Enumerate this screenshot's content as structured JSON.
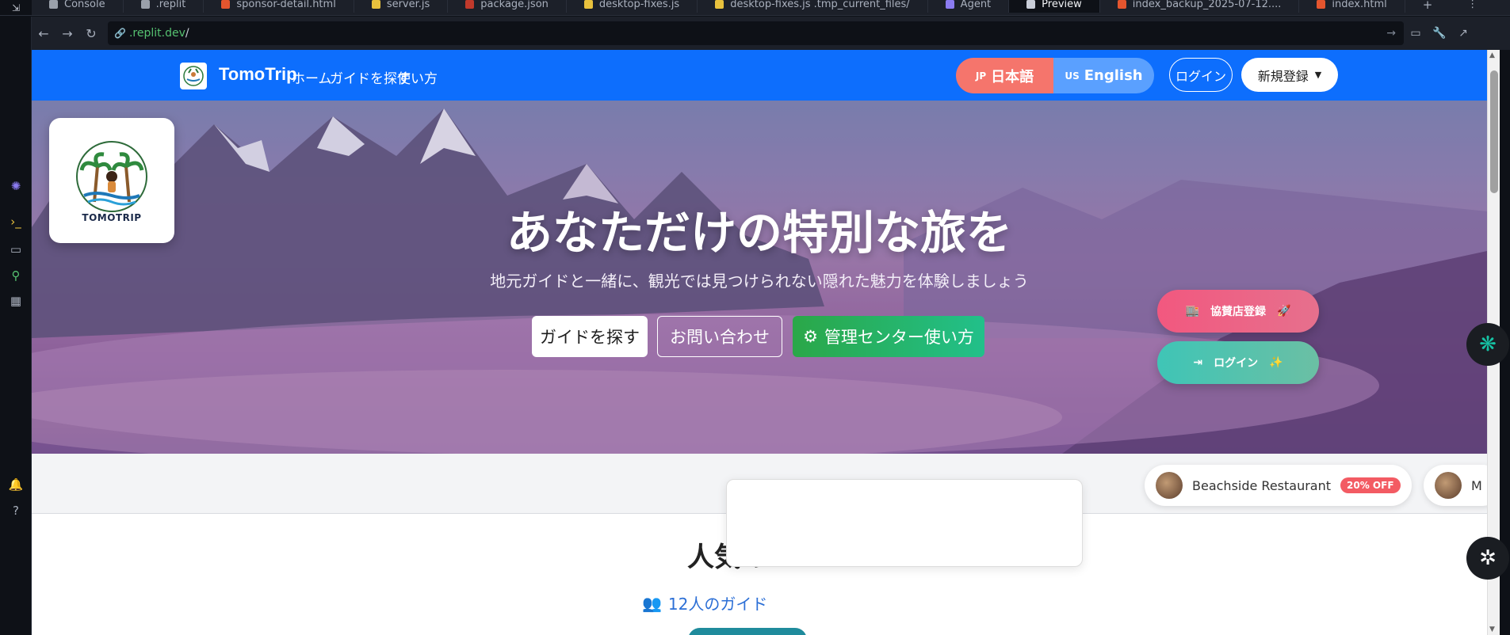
{
  "browser": {
    "tabs": [
      {
        "label": "Console",
        "color": "#9aa0aa"
      },
      {
        "label": ".replit",
        "color": "#9aa0aa"
      },
      {
        "label": "sponsor-detail.html",
        "color": "#e4552e"
      },
      {
        "label": "server.js",
        "color": "#e8c13d"
      },
      {
        "label": "package.json",
        "color": "#c0392b"
      },
      {
        "label": "desktop-fixes.js",
        "color": "#e8c13d"
      },
      {
        "label": "desktop-fixes.js .tmp_current_files/",
        "color": "#e8c13d"
      },
      {
        "label": "Agent",
        "color": "#8b7bf0"
      },
      {
        "label": "Preview",
        "color": "#c9ced8"
      },
      {
        "label": "index_backup_2025-07-12....",
        "color": "#e4552e"
      },
      {
        "label": "index.html",
        "color": "#e4552e"
      }
    ],
    "url_host": ".replit.dev",
    "url_path": "/"
  },
  "navbar": {
    "brand": "TomoTrip",
    "links": [
      "ホーム",
      "ガイドを探す",
      "使い方"
    ],
    "lang_jp_code": "JP",
    "lang_jp": "日本語",
    "lang_en_code": "US",
    "lang_en": "English",
    "login": "ログイン",
    "register": "新規登録"
  },
  "hero": {
    "logo_text": "TOMOTRIP",
    "title": "あなただけの特別な旅を",
    "subtitle": "地元ガイドと一緒に、観光では見つけられない隠れた魅力を体験しましょう",
    "btn_find": "ガイドを探す",
    "btn_contact": "お問い合わせ",
    "btn_admin": "管理センター使い方",
    "pill_sponsor": "協賛店登録",
    "pill_login": "ログイン"
  },
  "sponsors": [
    {
      "name": "Beachside Restaurant",
      "badge": "20% OFF"
    },
    {
      "name": "M",
      "badge": ""
    }
  ],
  "section": {
    "title": "人気の",
    "guide_count": "12人のガイド"
  },
  "colors": {
    "nav_blue": "#0d6efd",
    "jp_pill": "#f5756c",
    "en_pill": "#5aa0ff",
    "admin_green": "#2aa748",
    "sponsor_pink": "#f2587f",
    "login_teal": "#3fc5b6"
  },
  "icons": [
    "back-icon",
    "forward-icon",
    "reload-icon",
    "link-icon",
    "gear-icon",
    "store-icon",
    "login-icon",
    "users-icon",
    "chatgpt-icon"
  ]
}
